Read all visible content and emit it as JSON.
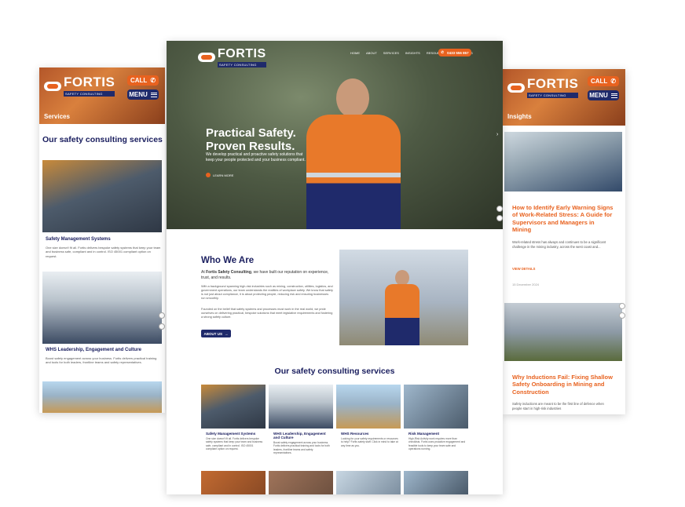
{
  "brand": {
    "name": "FORTIS",
    "tagline": "SAFETY CONSULTING"
  },
  "colors": {
    "orange": "#e8621f",
    "navy": "#1f2a6b",
    "text_navy": "#1c2060"
  },
  "left_mock": {
    "call_label": "CALL",
    "menu_label": "MENU",
    "page_title": "Services",
    "section_heading": "Our safety consulting services",
    "cards": [
      {
        "title": "Safety Management Systems",
        "body": "One size doesn't fit all. Fortis delivers bespoke safety systems that keep your team and business safe, compliant and in control. ISO 45001 compliant option on request."
      },
      {
        "title": "WHS Leadership, Engagement and Culture",
        "body": "Boost safety engagement across your business. Fortis delivers practical training and tools for both leaders, frontline teams and safety representatives."
      }
    ]
  },
  "center_mock": {
    "nav": [
      "HOME",
      "ABOUT",
      "SERVICES",
      "INSIGHTS",
      "RESOURCES",
      "CONTACT US"
    ],
    "phone_button": "0433 556 857",
    "hero_title_line1": "Practical Safety.",
    "hero_title_line2": "Proven Results.",
    "hero_sub": "We develop practical and proactive safety solutions that keep your people protected and your business compliant.",
    "hero_cta": "LEARN MORE",
    "who_heading": "Who We Are",
    "who_lead_prefix": "At",
    "who_lead_brand": "Fortis Safety Consulting",
    "who_lead_suffix": ", we have built our reputation on experience, trust, and results.",
    "who_p1": "With a background spanning high-risk industries such as mining, construction, utilities, logistics, and government operations, our team understands the realities of workplace safety. We know that safety is not just about compliance, it is about protecting people, reducing risk and ensuring businesses run smoothly.",
    "who_p2": "Founded on the belief that safety systems and processes must work in the real world, we pride ourselves on delivering practical, bespoke solutions that meet legislative requirements and fostering a strong safety culture.",
    "about_button": "ABOUT US",
    "services_heading": "Our safety consulting services",
    "services": [
      {
        "title": "Safety Management Systems",
        "body": "One size doesn't fit all. Fortis delivers bespoke safety systems that keep your team and business safe, compliant and in control. ISO 45001 compliant option on request."
      },
      {
        "title": "WHS Leadership, Engagement and Culture",
        "body": "Boost safety engagement across your business. Fortis delivers practical training and tools for both leaders, frontline teams and safety representatives."
      },
      {
        "title": "WHS Resources",
        "body": "Looking for your safety requirements or resources to help? Fortis safety staff. Click in mind to take at any time as you."
      },
      {
        "title": "Risk Management",
        "body": "High-Risk Activity work requires more than checklists. Fortis uses proactive engagement and feasible tools to keep your team safe and operations running."
      }
    ]
  },
  "right_mock": {
    "call_label": "CALL",
    "menu_label": "MENU",
    "page_title": "Insights",
    "articles": [
      {
        "title": "How to Identify Early Warning Signs of Work-Related Stress: A Guide for Supervisors and Managers in Mining",
        "excerpt": "Work-related stress has always and continues to be a significant challenge in the mining industry, across the west coast and...",
        "cta": "VIEW DETAILS",
        "date": "15 December 2024"
      },
      {
        "title": "Why Inductions Fail: Fixing Shallow Safety Onboarding in Mining and Construction",
        "excerpt": "Safety inductions are meant to be the first line of defence when people start in high-risk industries"
      }
    ]
  }
}
